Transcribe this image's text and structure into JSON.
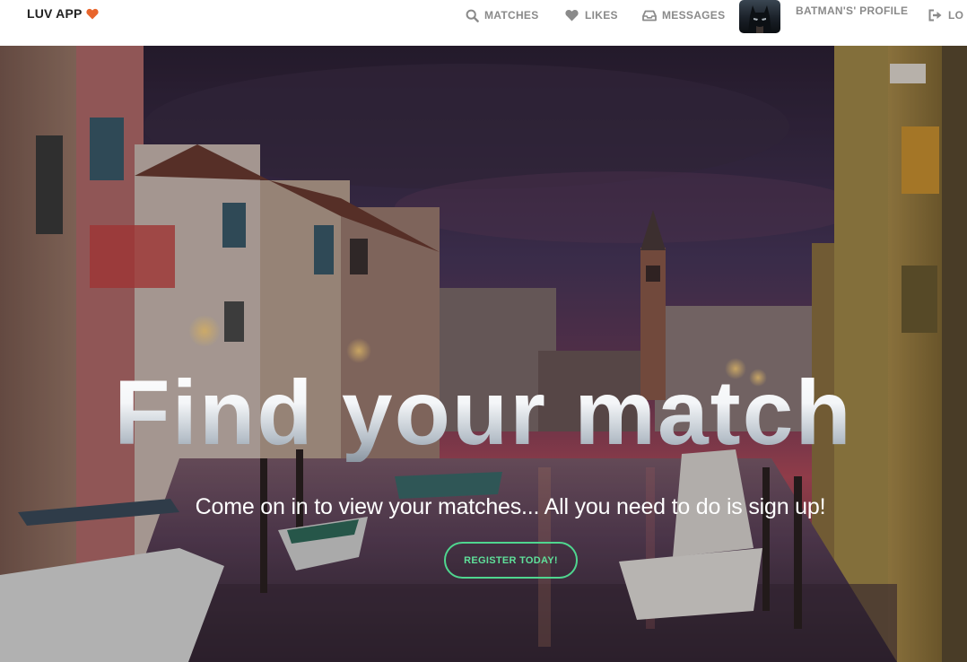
{
  "brand": {
    "label": "LUV APP",
    "icon": "heart-icon",
    "accent": "#e8652c"
  },
  "nav": {
    "matches": {
      "label": "MATCHES",
      "icon": "search-icon"
    },
    "likes": {
      "label": "LIKES",
      "icon": "heart-icon"
    },
    "messages": {
      "label": "MESSAGES",
      "icon": "inbox-icon"
    },
    "profile": {
      "label": "BATMAN'S' PROFILE",
      "avatar": "batman-avatar"
    },
    "logout": {
      "label": "LO",
      "icon": "logout-icon"
    }
  },
  "hero": {
    "title": "Find your match",
    "subtitle": "Come on in to view your matches... All you need to do is sign up!",
    "cta_label": "REGISTER TODAY!",
    "cta_color": "#4fd68f",
    "background": "venice-canal-dusk"
  },
  "colors": {
    "nav_text": "#8a8a8a",
    "brand_text": "#222222"
  }
}
